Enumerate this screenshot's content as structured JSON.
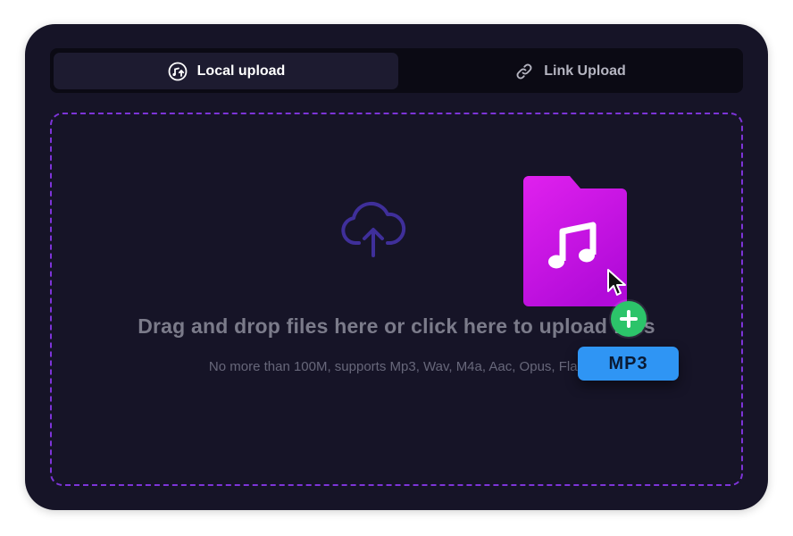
{
  "tabs": [
    {
      "label": "Local upload",
      "icon": "music-upload-icon",
      "active": true
    },
    {
      "label": "Link Upload",
      "icon": "link-icon",
      "active": false
    }
  ],
  "dropzone": {
    "icon": "cloud-upload-icon",
    "headline": "Drag and drop files here or click here to upload files",
    "subtext": "No more than 100M, supports Mp3, Wav, M4a, Aac, Opus, Flac"
  },
  "illustration": {
    "folder_icon": "music-note-icon",
    "badge_label": "MP3",
    "add_icon": "plus-icon"
  },
  "colors": {
    "card_bg": "#161427",
    "accent_purple": "#7d34d8",
    "folder_magenta": "#d21ee8",
    "plus_green": "#2cc46a",
    "badge_blue": "#2f95f4"
  }
}
